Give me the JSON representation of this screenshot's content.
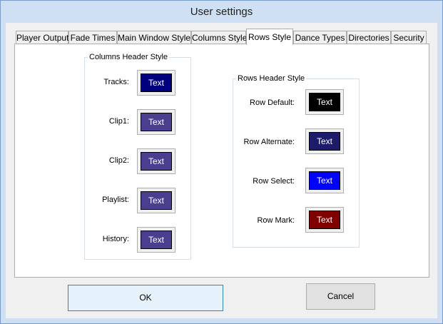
{
  "window": {
    "title": "User settings"
  },
  "tabs": [
    {
      "label": "Player Output"
    },
    {
      "label": "Fade Times"
    },
    {
      "label": "Main Window Style"
    },
    {
      "label": "Columns Style"
    },
    {
      "label": "Rows Style",
      "active": true
    },
    {
      "label": "Dance Types"
    },
    {
      "label": "Directories"
    },
    {
      "label": "Security"
    }
  ],
  "columns_header": {
    "title": "Columns Header Style",
    "items": [
      {
        "label": "Tracks:",
        "sample": "Text",
        "bg": "#00007f"
      },
      {
        "label": "Clip1:",
        "sample": "Text",
        "bg": "#4a3f8f"
      },
      {
        "label": "Clip2:",
        "sample": "Text",
        "bg": "#4a3f8f"
      },
      {
        "label": "Playlist:",
        "sample": "Text",
        "bg": "#4a3f8f"
      },
      {
        "label": "History:",
        "sample": "Text",
        "bg": "#4a3f8f"
      }
    ]
  },
  "rows_header": {
    "title": "Rows Header Style",
    "items": [
      {
        "label": "Row Default:",
        "sample": "Text",
        "bg": "#000000"
      },
      {
        "label": "Row Alternate:",
        "sample": "Text",
        "bg": "#1c1c6a"
      },
      {
        "label": "Row Select:",
        "sample": "Text",
        "bg": "#0000ff"
      },
      {
        "label": "Row Mark:",
        "sample": "Text",
        "bg": "#800000"
      }
    ]
  },
  "buttons": {
    "ok": "OK",
    "cancel": "Cancel"
  }
}
